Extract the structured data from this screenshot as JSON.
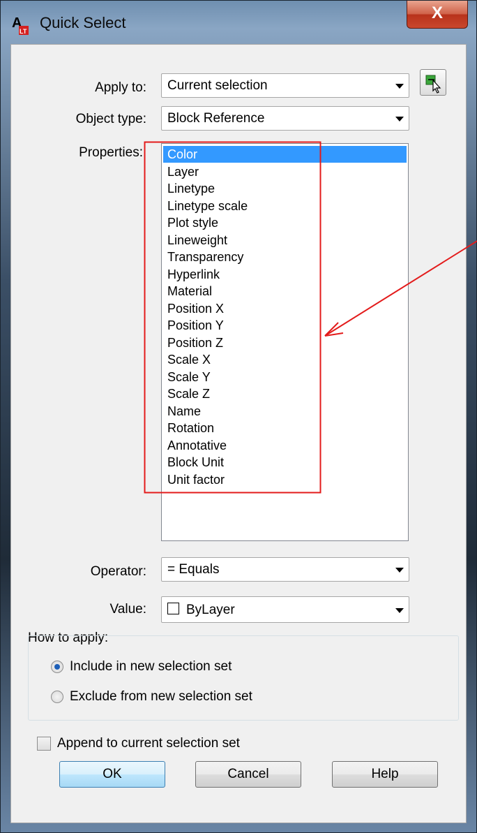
{
  "window": {
    "title": "Quick Select",
    "close_glyph": "X",
    "app_icon": "autocad-lt-icon"
  },
  "apply_to": {
    "label": "Apply to:",
    "value": "Current selection",
    "select_objects_icon": "select-objects-icon"
  },
  "object_type": {
    "label": "Object type:",
    "value": "Block Reference"
  },
  "properties": {
    "label": "Properties:",
    "items": [
      "Color",
      "Layer",
      "Linetype",
      "Linetype scale",
      "Plot style",
      "Lineweight",
      "Transparency",
      "Hyperlink",
      "Material",
      "Position X",
      "Position Y",
      "Position Z",
      "Scale X",
      "Scale Y",
      "Scale Z",
      "Name",
      "Rotation",
      "Annotative",
      "Block Unit",
      "Unit factor"
    ],
    "selected": "Color"
  },
  "operator": {
    "label": "Operator:",
    "value": "= Equals"
  },
  "value": {
    "label": "Value:",
    "value": "ByLayer",
    "swatch_color": "#ffffff"
  },
  "how_to_apply": {
    "label": "How to apply:",
    "include": {
      "label": "Include in new selection set",
      "checked": true
    },
    "exclude": {
      "label": "Exclude from new selection set",
      "checked": false
    }
  },
  "append": {
    "label": "Append to current selection set",
    "checked": false
  },
  "buttons": {
    "ok": "OK",
    "cancel": "Cancel",
    "help": "Help"
  },
  "annotation": {
    "color": "#e31b1b"
  }
}
